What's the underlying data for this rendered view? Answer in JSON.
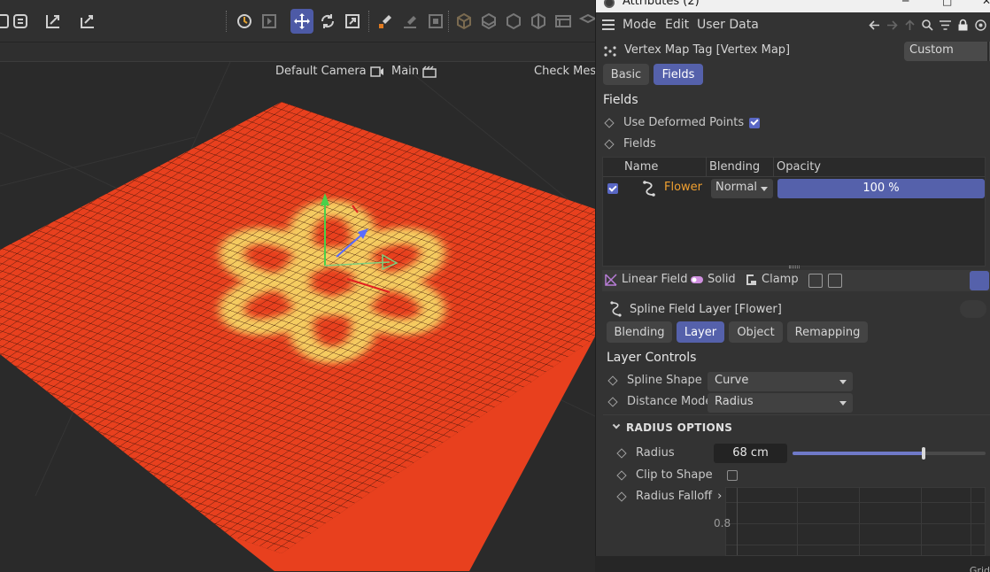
{
  "toolbar": {
    "icons": [
      "object-icon",
      "expand-icon",
      "export-icon",
      "tweak-icon",
      "view-icon",
      "move-icon",
      "rotate-icon",
      "scale-icon",
      "brush-icon",
      "paint-icon",
      "solo-icon",
      "cube-icon",
      "cube2-icon",
      "cube3-icon",
      "cube4-icon",
      "table-icon",
      "layers-icon"
    ],
    "active_tool": "move-icon"
  },
  "viewport": {
    "camera_label": "Default Camera",
    "take_label": "Main",
    "mesh_label": "Check Mesh",
    "colors": {
      "background": "#2a2a2a",
      "plane": "#e8401e",
      "grid_line": "#3a1208",
      "highlight": "#f5cc60"
    }
  },
  "window": {
    "title": "Attributes (2)"
  },
  "attributes": {
    "menu": [
      "Mode",
      "Edit",
      "User Data"
    ],
    "object_title": "Vertex Map Tag [Vertex Map]",
    "preset": "Custom",
    "tabs": [
      {
        "label": "Basic",
        "selected": false
      },
      {
        "label": "Fields",
        "selected": true
      }
    ],
    "fields_section": {
      "title": "Fields",
      "use_deformed_points_label": "Use Deformed Points",
      "use_deformed_points": true,
      "fields_label": "Fields",
      "list": {
        "headers": [
          "Name",
          "Blending",
          "Opacity"
        ],
        "rows": [
          {
            "enabled": true,
            "name": "Flower",
            "blending": "Normal",
            "opacity": "100 %",
            "opacity_value": 100
          }
        ]
      }
    },
    "layer_toolbar": [
      "Linear Field",
      "Solid",
      "Clamp"
    ],
    "layer_title": "Spline Field Layer [Flower]",
    "layer_tabs": [
      {
        "label": "Blending",
        "selected": false
      },
      {
        "label": "Layer",
        "selected": true
      },
      {
        "label": "Object",
        "selected": false
      },
      {
        "label": "Remapping",
        "selected": false
      }
    ],
    "layer_controls": {
      "title": "Layer Controls",
      "spline_shape_label": "Spline Shape",
      "spline_shape": "Curve",
      "distance_mode_label": "Distance Mode",
      "distance_mode": "Radius"
    },
    "radius_options": {
      "title": "RADIUS OPTIONS",
      "radius_label": "Radius",
      "radius_value": "68 cm",
      "radius_slider_fraction": 0.68,
      "clip_label": "Clip to Shape",
      "clip": false,
      "falloff_label": "Radius Falloff",
      "graph_tick": "0.8"
    },
    "accent_color": "#5561ab"
  },
  "status": {
    "corner_text": "Grid"
  }
}
